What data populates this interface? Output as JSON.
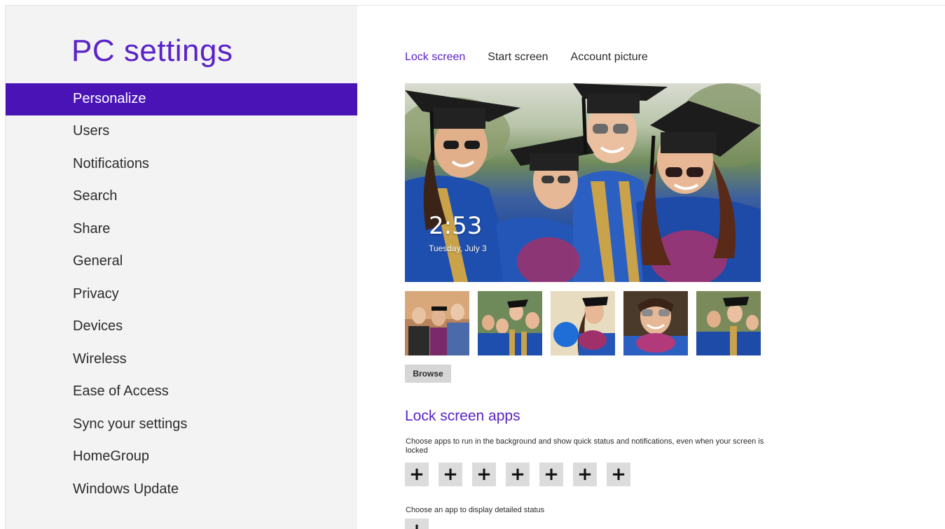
{
  "sidebar": {
    "title": "PC settings",
    "items": [
      {
        "label": "Personalize",
        "selected": true
      },
      {
        "label": "Users"
      },
      {
        "label": "Notifications"
      },
      {
        "label": "Search"
      },
      {
        "label": "Share"
      },
      {
        "label": "General"
      },
      {
        "label": "Privacy"
      },
      {
        "label": "Devices"
      },
      {
        "label": "Wireless"
      },
      {
        "label": "Ease of Access"
      },
      {
        "label": "Sync your settings"
      },
      {
        "label": "HomeGroup"
      },
      {
        "label": "Windows Update"
      }
    ]
  },
  "tabs": [
    {
      "label": "Lock screen",
      "active": true
    },
    {
      "label": "Start screen"
    },
    {
      "label": "Account picture"
    }
  ],
  "lock_preview": {
    "time": "2:53",
    "date": "Tuesday, July 3"
  },
  "browse_label": "Browse",
  "lock_apps": {
    "title": "Lock screen apps",
    "description": "Choose apps to run in the background and show quick status and notifications, even when your screen is locked",
    "plus_symbol": "+",
    "detailed_status_label": "Choose an app to display detailed status"
  },
  "colors": {
    "accent": "#5a23c8",
    "selected_bg": "#4a13b5",
    "sidebar_bg": "#f3f3f3"
  }
}
